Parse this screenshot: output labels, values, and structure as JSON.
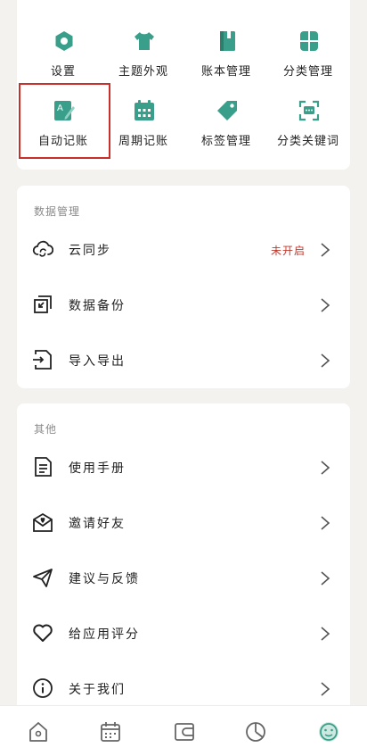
{
  "grid": [
    {
      "label": "设置",
      "icon": "gear-icon"
    },
    {
      "label": "主题外观",
      "icon": "shirt-icon"
    },
    {
      "label": "账本管理",
      "icon": "book-icon"
    },
    {
      "label": "分类管理",
      "icon": "clover-icon"
    },
    {
      "label": "自动记账",
      "icon": "auto-note-icon"
    },
    {
      "label": "周期记账",
      "icon": "calendar-icon"
    },
    {
      "label": "标签管理",
      "icon": "tag-icon"
    },
    {
      "label": "分类关键词",
      "icon": "keyword-scan-icon"
    }
  ],
  "data_section": {
    "title": "数据管理",
    "rows": [
      {
        "label": "云同步",
        "status": "未开启",
        "icon": "cloud-sync-icon"
      },
      {
        "label": "数据备份",
        "icon": "backup-icon"
      },
      {
        "label": "导入导出",
        "icon": "import-export-icon"
      }
    ]
  },
  "other_section": {
    "title": "其他",
    "rows": [
      {
        "label": "使用手册",
        "icon": "manual-icon"
      },
      {
        "label": "邀请好友",
        "icon": "invite-icon"
      },
      {
        "label": "建议与反馈",
        "icon": "send-feedback-icon"
      },
      {
        "label": "给应用评分",
        "icon": "heart-icon"
      },
      {
        "label": "关于我们",
        "icon": "info-icon"
      }
    ]
  },
  "tabbar": [
    "home-icon",
    "calendar-tab-icon",
    "wallet-icon",
    "pie-chart-icon",
    "profile-face-icon"
  ],
  "colors": {
    "accent": "#3a9f8a",
    "status": "#c0392b",
    "highlight": "#c9302c"
  }
}
